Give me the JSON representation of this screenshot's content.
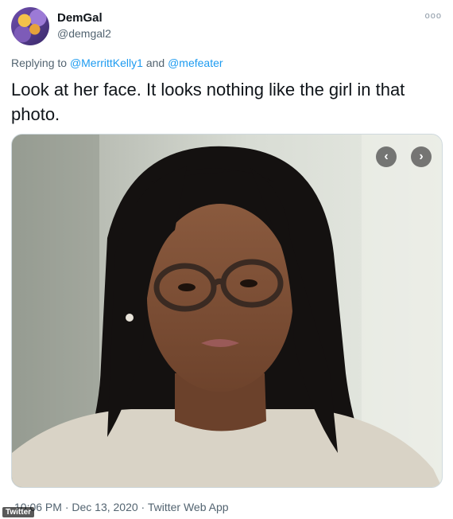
{
  "author": {
    "display_name": "DemGal",
    "handle": "@demgal2",
    "avatar_icon": "avatar-flowers-icon"
  },
  "more_menu": {
    "icon": "more-options-icon",
    "glyph": "ooo"
  },
  "reply_context": {
    "prefix": "Replying to ",
    "mention_1": "@MerrittKelly1",
    "conjunction": " and ",
    "mention_2": "@mefeater"
  },
  "tweet": {
    "text": "Look at her face. It looks nothing like the girl in that photo."
  },
  "media": {
    "prev_glyph": "‹",
    "next_glyph": "›"
  },
  "metadata": {
    "timestamp": "10:06 PM · Dec 13, 2020 · Twitter Web App"
  },
  "watermark": {
    "label": "Twitter"
  },
  "colors": {
    "link": "#1d9bf0",
    "secondary_text": "#536471",
    "primary_text": "#0f1419"
  }
}
